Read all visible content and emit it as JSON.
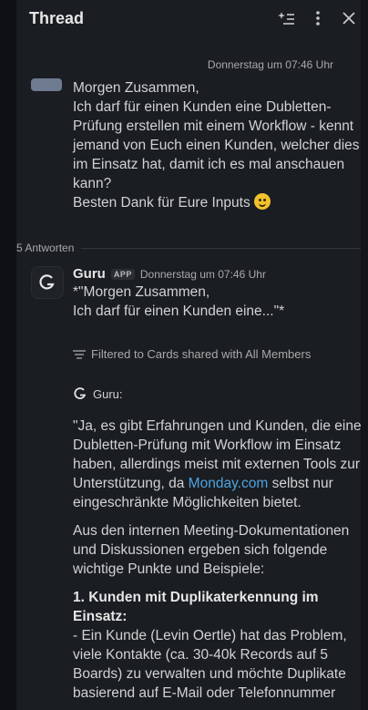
{
  "header": {
    "title": "Thread"
  },
  "thread_date": "Donnerstag um 07:46 Uhr",
  "original_message": {
    "lines": [
      "Morgen Zusammen,",
      "Ich darf für einen Kunden eine Dubletten-",
      "Prüfung erstellen mit einem Workflow - kennt",
      "jemand von Euch einen Kunden, welcher dies",
      "im Einsatz hat, damit ich es mal anschauen",
      "kann?",
      "Besten Dank für Eure Inputs"
    ]
  },
  "replies_label": "5 Antworten",
  "guru_reply": {
    "name": "Guru",
    "badge": "APP",
    "timestamp": "Donnerstag um 07:46 Uhr",
    "quote_lines": [
      "*\"Morgen Zusammen,",
      "Ich darf für einen Kunden eine...\"*"
    ],
    "filter_text": "Filtered to Cards shared with All Members",
    "guru_label": "Guru:",
    "paragraph1_pre": "\"Ja, es gibt Erfahrungen und Kunden, die eine Dubletten-Prüfung mit Workflow im Einsatz haben, allerdings meist mit externen Tools zur Unterstützung, da ",
    "paragraph1_link": "Monday.com",
    "paragraph1_post": " selbst nur eingeschränkte Möglichkeiten bietet.",
    "paragraph2": "Aus den internen Meeting-Dokumentationen und Diskussionen ergeben sich folgende wichtige Punkte und Beispiele:",
    "list_item1_title": "1. Kunden mit Duplikaterkennung im Einsatz:",
    "list_item1_text": "- Ein Kunde (Levin Oertle) hat das Problem, viele Kontakte (ca. 30-40k Records auf 5 Boards) zu verwalten und möchte Duplikate basierend auf E-Mail oder Telefonnummer"
  }
}
